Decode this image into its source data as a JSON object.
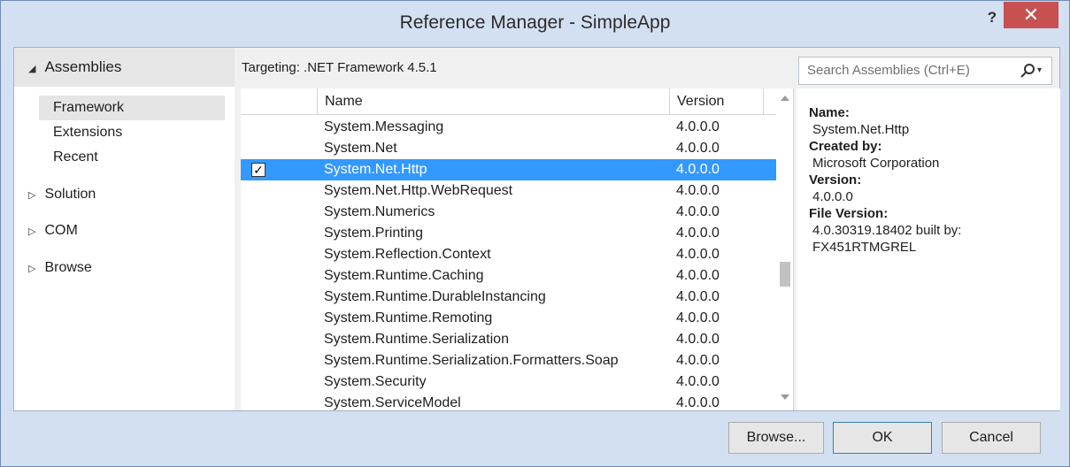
{
  "window": {
    "title": "Reference Manager - SimpleApp",
    "help_label": "?",
    "close_label": "✕"
  },
  "nav": {
    "header": "Assemblies",
    "subitems": [
      "Framework",
      "Extensions",
      "Recent"
    ],
    "groups": [
      "Solution",
      "COM",
      "Browse"
    ]
  },
  "targeting": "Targeting: .NET Framework 4.5.1",
  "search": {
    "placeholder": "Search Assemblies (Ctrl+E)"
  },
  "grid": {
    "columns": [
      "Name",
      "Version"
    ],
    "rows": [
      {
        "name": "System.Messaging",
        "version": "4.0.0.0",
        "checked": false,
        "selected": false
      },
      {
        "name": "System.Net",
        "version": "4.0.0.0",
        "checked": false,
        "selected": false
      },
      {
        "name": "System.Net.Http",
        "version": "4.0.0.0",
        "checked": true,
        "selected": true
      },
      {
        "name": "System.Net.Http.WebRequest",
        "version": "4.0.0.0",
        "checked": false,
        "selected": false
      },
      {
        "name": "System.Numerics",
        "version": "4.0.0.0",
        "checked": false,
        "selected": false
      },
      {
        "name": "System.Printing",
        "version": "4.0.0.0",
        "checked": false,
        "selected": false
      },
      {
        "name": "System.Reflection.Context",
        "version": "4.0.0.0",
        "checked": false,
        "selected": false
      },
      {
        "name": "System.Runtime.Caching",
        "version": "4.0.0.0",
        "checked": false,
        "selected": false
      },
      {
        "name": "System.Runtime.DurableInstancing",
        "version": "4.0.0.0",
        "checked": false,
        "selected": false
      },
      {
        "name": "System.Runtime.Remoting",
        "version": "4.0.0.0",
        "checked": false,
        "selected": false
      },
      {
        "name": "System.Runtime.Serialization",
        "version": "4.0.0.0",
        "checked": false,
        "selected": false
      },
      {
        "name": "System.Runtime.Serialization.Formatters.Soap",
        "version": "4.0.0.0",
        "checked": false,
        "selected": false
      },
      {
        "name": "System.Security",
        "version": "4.0.0.0",
        "checked": false,
        "selected": false
      },
      {
        "name": "System.ServiceModel",
        "version": "4.0.0.0",
        "checked": false,
        "selected": false
      }
    ]
  },
  "details": {
    "name_label": "Name:",
    "name_value": "System.Net.Http",
    "created_label": "Created by:",
    "created_value": "Microsoft Corporation",
    "version_label": "Version:",
    "version_value": "4.0.0.0",
    "fileversion_label": "File Version:",
    "fileversion_value_1": "4.0.30319.18402 built by:",
    "fileversion_value_2": "FX451RTMGREL"
  },
  "buttons": {
    "browse": "Browse...",
    "ok": "OK",
    "cancel": "Cancel"
  },
  "colors": {
    "selection": "#3399ff",
    "close": "#c75050",
    "chrome": "#d2e0f2"
  }
}
